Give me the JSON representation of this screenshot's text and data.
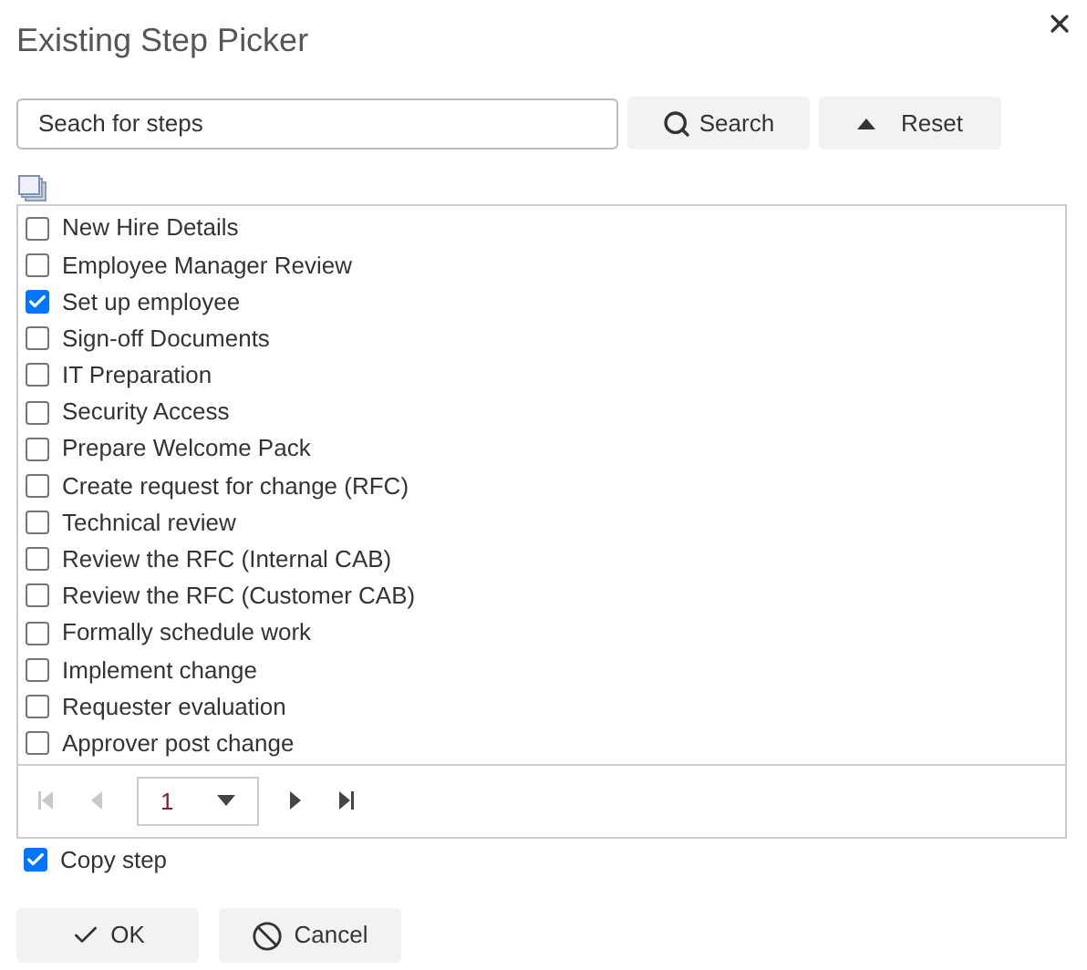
{
  "dialog": {
    "title": "Existing Step Picker"
  },
  "search": {
    "placeholder": "Seach for steps",
    "search_button": "Search",
    "reset_button": "Reset"
  },
  "steps": [
    {
      "label": "New Hire Details",
      "checked": false
    },
    {
      "label": "Employee Manager Review",
      "checked": false
    },
    {
      "label": "Set up employee",
      "checked": true
    },
    {
      "label": "Sign-off Documents",
      "checked": false
    },
    {
      "label": "IT Preparation",
      "checked": false
    },
    {
      "label": "Security Access",
      "checked": false
    },
    {
      "label": "Prepare Welcome Pack",
      "checked": false
    },
    {
      "label": "Create request for change (RFC)",
      "checked": false
    },
    {
      "label": "Technical review",
      "checked": false
    },
    {
      "label": "Review the RFC (Internal CAB)",
      "checked": false
    },
    {
      "label": "Review the RFC (Customer CAB)",
      "checked": false
    },
    {
      "label": "Formally schedule work",
      "checked": false
    },
    {
      "label": "Implement change",
      "checked": false
    },
    {
      "label": "Requester evaluation",
      "checked": false
    },
    {
      "label": "Approver post change",
      "checked": false
    }
  ],
  "pager": {
    "page": "1",
    "first_disabled": true,
    "prev_disabled": true,
    "next_disabled": false,
    "last_disabled": false
  },
  "copy_step": {
    "label": "Copy step",
    "checked": true
  },
  "buttons": {
    "ok": "OK",
    "cancel": "Cancel"
  }
}
